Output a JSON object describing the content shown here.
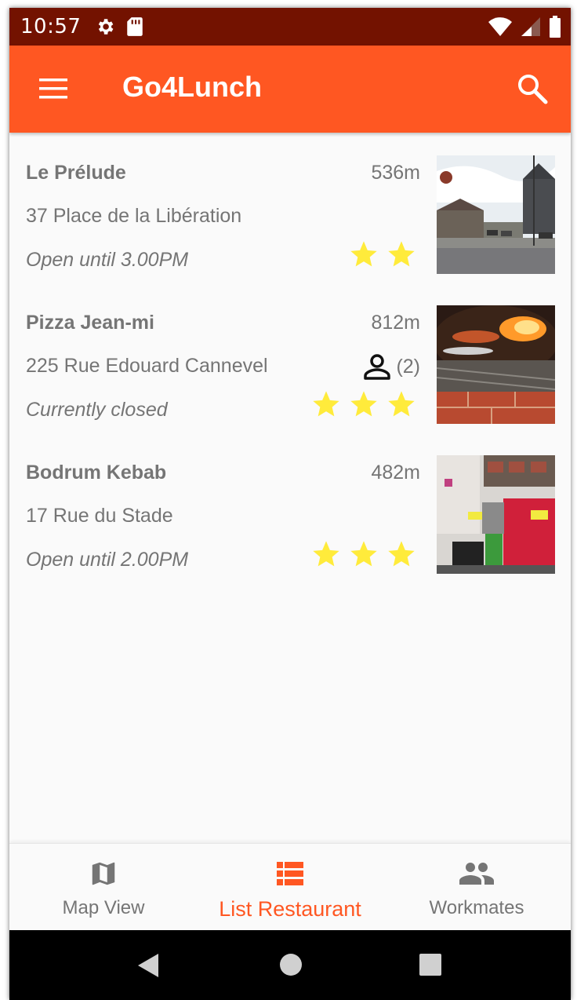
{
  "status_bar": {
    "time": "10:57"
  },
  "app_bar": {
    "title": "Go4Lunch"
  },
  "restaurants": [
    {
      "name": "Le Prélude",
      "distance": "536m",
      "address": "37 Place de la Libération",
      "hours": "Open until  3.00PM",
      "rating": 2,
      "workmates": null
    },
    {
      "name": "Pizza Jean-mi",
      "distance": "812m",
      "address": "225 Rue Edouard Cannevel",
      "hours": "Currently closed",
      "rating": 3,
      "workmates": "(2)"
    },
    {
      "name": "Bodrum Kebab",
      "distance": "482m",
      "address": "17 Rue du Stade",
      "hours": "Open until  2.00PM",
      "rating": 3,
      "workmates": null
    }
  ],
  "bottom_nav": {
    "tabs": [
      {
        "label": "Map View",
        "icon": "map-icon",
        "active": false
      },
      {
        "label": "List Restaurant",
        "icon": "list-icon",
        "active": true
      },
      {
        "label": "Workmates",
        "icon": "people-icon",
        "active": false
      }
    ]
  },
  "colors": {
    "primary": "#ff5722",
    "primary_dark": "#731200",
    "star": "#ffeb3b",
    "text_secondary": "#757575"
  }
}
